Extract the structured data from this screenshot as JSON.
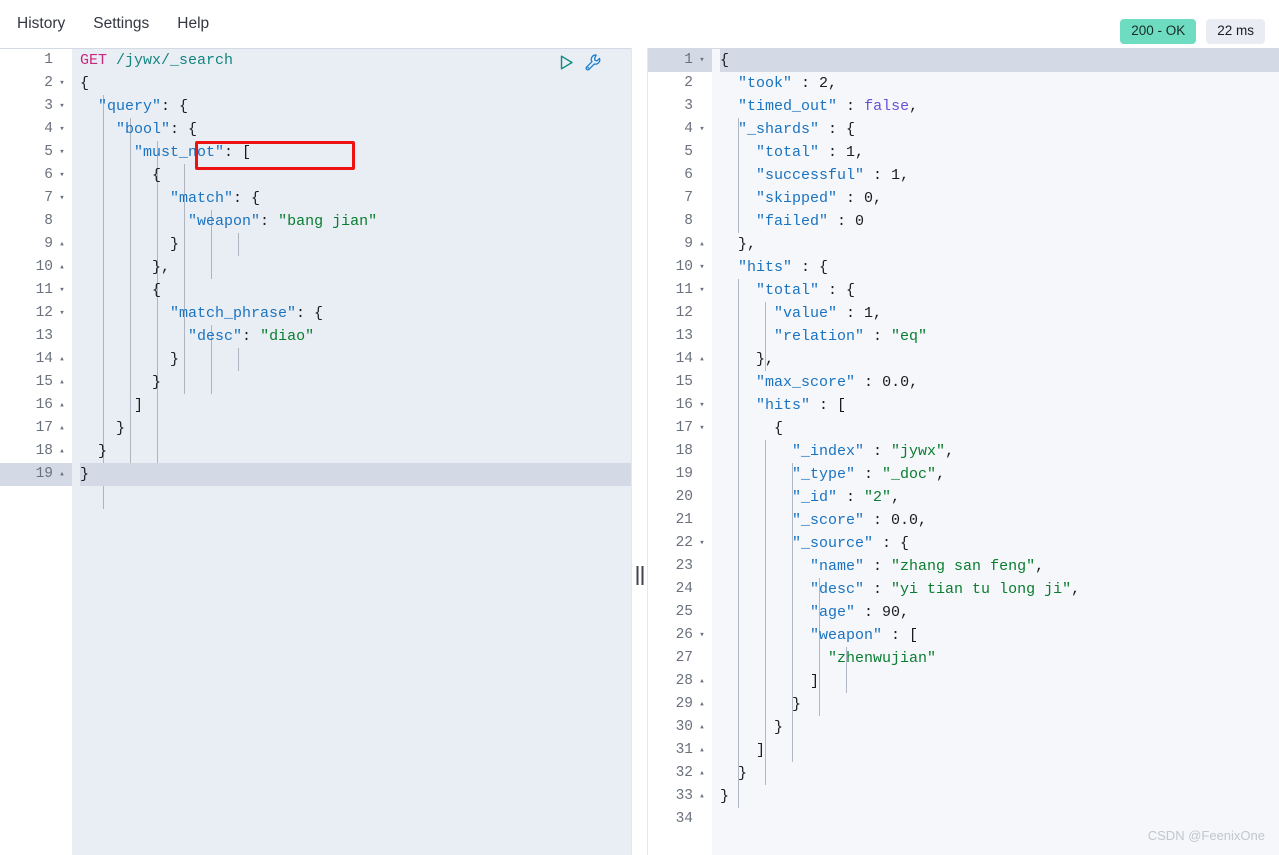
{
  "topbar": {
    "menu": [
      {
        "label": "History",
        "name": "menu-history"
      },
      {
        "label": "Settings",
        "name": "menu-settings"
      },
      {
        "label": "Help",
        "name": "menu-help"
      }
    ],
    "status_badge": "200 - OK",
    "time_badge": "22 ms",
    "status_color": "#6ddcc0"
  },
  "watermark": "CSDN @FeenixOne",
  "request_editor": {
    "active_line": 19,
    "run_icon": "play-icon",
    "wrench_icon": "wrench-icon",
    "lines": [
      {
        "n": 1,
        "fold": "",
        "tokens": [
          {
            "c": "t-method",
            "t": "GET"
          },
          {
            "c": "t-plain",
            "t": " "
          },
          {
            "c": "t-url",
            "t": "/jywx/_search"
          }
        ]
      },
      {
        "n": 2,
        "fold": "▾",
        "tokens": [
          {
            "c": "t-punc",
            "t": "{"
          }
        ]
      },
      {
        "n": 3,
        "fold": "▾",
        "tokens": [
          {
            "c": "t-plain",
            "t": "  "
          },
          {
            "c": "t-key",
            "t": "\"query\""
          },
          {
            "c": "t-punc",
            "t": ": {"
          }
        ]
      },
      {
        "n": 4,
        "fold": "▾",
        "tokens": [
          {
            "c": "t-plain",
            "t": "    "
          },
          {
            "c": "t-key",
            "t": "\"bool\""
          },
          {
            "c": "t-punc",
            "t": ": {"
          }
        ]
      },
      {
        "n": 5,
        "fold": "▾",
        "tokens": [
          {
            "c": "t-plain",
            "t": "      "
          },
          {
            "c": "t-key",
            "t": "\"must_not\""
          },
          {
            "c": "t-punc",
            "t": ": ["
          }
        ]
      },
      {
        "n": 6,
        "fold": "▾",
        "tokens": [
          {
            "c": "t-plain",
            "t": "        "
          },
          {
            "c": "t-punc",
            "t": "{"
          }
        ]
      },
      {
        "n": 7,
        "fold": "▾",
        "tokens": [
          {
            "c": "t-plain",
            "t": "          "
          },
          {
            "c": "t-key",
            "t": "\"match\""
          },
          {
            "c": "t-punc",
            "t": ": {"
          }
        ]
      },
      {
        "n": 8,
        "fold": "",
        "tokens": [
          {
            "c": "t-plain",
            "t": "            "
          },
          {
            "c": "t-key",
            "t": "\"weapon\""
          },
          {
            "c": "t-punc",
            "t": ": "
          },
          {
            "c": "t-str",
            "t": "\"bang jian\""
          }
        ]
      },
      {
        "n": 9,
        "fold": "▴",
        "tokens": [
          {
            "c": "t-plain",
            "t": "          "
          },
          {
            "c": "t-punc",
            "t": "}"
          }
        ]
      },
      {
        "n": 10,
        "fold": "▴",
        "tokens": [
          {
            "c": "t-plain",
            "t": "        "
          },
          {
            "c": "t-punc",
            "t": "},"
          }
        ]
      },
      {
        "n": 11,
        "fold": "▾",
        "tokens": [
          {
            "c": "t-plain",
            "t": "        "
          },
          {
            "c": "t-punc",
            "t": "{"
          }
        ]
      },
      {
        "n": 12,
        "fold": "▾",
        "tokens": [
          {
            "c": "t-plain",
            "t": "          "
          },
          {
            "c": "t-key",
            "t": "\"match_phrase\""
          },
          {
            "c": "t-punc",
            "t": ": {"
          }
        ]
      },
      {
        "n": 13,
        "fold": "",
        "tokens": [
          {
            "c": "t-plain",
            "t": "            "
          },
          {
            "c": "t-key",
            "t": "\"desc\""
          },
          {
            "c": "t-punc",
            "t": ": "
          },
          {
            "c": "t-str",
            "t": "\"diao\""
          }
        ]
      },
      {
        "n": 14,
        "fold": "▴",
        "tokens": [
          {
            "c": "t-plain",
            "t": "          "
          },
          {
            "c": "t-punc",
            "t": "}"
          }
        ]
      },
      {
        "n": 15,
        "fold": "▴",
        "tokens": [
          {
            "c": "t-plain",
            "t": "        "
          },
          {
            "c": "t-punc",
            "t": "}"
          }
        ]
      },
      {
        "n": 16,
        "fold": "▴",
        "tokens": [
          {
            "c": "t-plain",
            "t": "      "
          },
          {
            "c": "t-punc",
            "t": "]"
          }
        ]
      },
      {
        "n": 17,
        "fold": "▴",
        "tokens": [
          {
            "c": "t-plain",
            "t": "    "
          },
          {
            "c": "t-punc",
            "t": "}"
          }
        ]
      },
      {
        "n": 18,
        "fold": "▴",
        "tokens": [
          {
            "c": "t-plain",
            "t": "  "
          },
          {
            "c": "t-punc",
            "t": "}"
          }
        ]
      },
      {
        "n": 19,
        "fold": "▴",
        "tokens": [
          {
            "c": "t-punc",
            "t": "}"
          }
        ]
      }
    ]
  },
  "response_editor": {
    "active_line": 1,
    "lines": [
      {
        "n": 1,
        "fold": "▾",
        "tokens": [
          {
            "c": "t-punc",
            "t": "{"
          }
        ]
      },
      {
        "n": 2,
        "fold": "",
        "tokens": [
          {
            "c": "t-plain",
            "t": "  "
          },
          {
            "c": "t-key",
            "t": "\"took\""
          },
          {
            "c": "t-punc",
            "t": " : "
          },
          {
            "c": "t-num",
            "t": "2,"
          }
        ]
      },
      {
        "n": 3,
        "fold": "",
        "tokens": [
          {
            "c": "t-plain",
            "t": "  "
          },
          {
            "c": "t-key",
            "t": "\"timed_out\""
          },
          {
            "c": "t-punc",
            "t": " : "
          },
          {
            "c": "t-bool",
            "t": "false"
          },
          {
            "c": "t-punc",
            "t": ","
          }
        ]
      },
      {
        "n": 4,
        "fold": "▾",
        "tokens": [
          {
            "c": "t-plain",
            "t": "  "
          },
          {
            "c": "t-key",
            "t": "\"_shards\""
          },
          {
            "c": "t-punc",
            "t": " : {"
          }
        ]
      },
      {
        "n": 5,
        "fold": "",
        "tokens": [
          {
            "c": "t-plain",
            "t": "    "
          },
          {
            "c": "t-key",
            "t": "\"total\""
          },
          {
            "c": "t-punc",
            "t": " : "
          },
          {
            "c": "t-num",
            "t": "1,"
          }
        ]
      },
      {
        "n": 6,
        "fold": "",
        "tokens": [
          {
            "c": "t-plain",
            "t": "    "
          },
          {
            "c": "t-key",
            "t": "\"successful\""
          },
          {
            "c": "t-punc",
            "t": " : "
          },
          {
            "c": "t-num",
            "t": "1,"
          }
        ]
      },
      {
        "n": 7,
        "fold": "",
        "tokens": [
          {
            "c": "t-plain",
            "t": "    "
          },
          {
            "c": "t-key",
            "t": "\"skipped\""
          },
          {
            "c": "t-punc",
            "t": " : "
          },
          {
            "c": "t-num",
            "t": "0,"
          }
        ]
      },
      {
        "n": 8,
        "fold": "",
        "tokens": [
          {
            "c": "t-plain",
            "t": "    "
          },
          {
            "c": "t-key",
            "t": "\"failed\""
          },
          {
            "c": "t-punc",
            "t": " : "
          },
          {
            "c": "t-num",
            "t": "0"
          }
        ]
      },
      {
        "n": 9,
        "fold": "▴",
        "tokens": [
          {
            "c": "t-plain",
            "t": "  "
          },
          {
            "c": "t-punc",
            "t": "},"
          }
        ]
      },
      {
        "n": 10,
        "fold": "▾",
        "tokens": [
          {
            "c": "t-plain",
            "t": "  "
          },
          {
            "c": "t-key",
            "t": "\"hits\""
          },
          {
            "c": "t-punc",
            "t": " : {"
          }
        ]
      },
      {
        "n": 11,
        "fold": "▾",
        "tokens": [
          {
            "c": "t-plain",
            "t": "    "
          },
          {
            "c": "t-key",
            "t": "\"total\""
          },
          {
            "c": "t-punc",
            "t": " : {"
          }
        ]
      },
      {
        "n": 12,
        "fold": "",
        "tokens": [
          {
            "c": "t-plain",
            "t": "      "
          },
          {
            "c": "t-key",
            "t": "\"value\""
          },
          {
            "c": "t-punc",
            "t": " : "
          },
          {
            "c": "t-num",
            "t": "1,"
          }
        ]
      },
      {
        "n": 13,
        "fold": "",
        "tokens": [
          {
            "c": "t-plain",
            "t": "      "
          },
          {
            "c": "t-key",
            "t": "\"relation\""
          },
          {
            "c": "t-punc",
            "t": " : "
          },
          {
            "c": "t-str",
            "t": "\"eq\""
          }
        ]
      },
      {
        "n": 14,
        "fold": "▴",
        "tokens": [
          {
            "c": "t-plain",
            "t": "    "
          },
          {
            "c": "t-punc",
            "t": "},"
          }
        ]
      },
      {
        "n": 15,
        "fold": "",
        "tokens": [
          {
            "c": "t-plain",
            "t": "    "
          },
          {
            "c": "t-key",
            "t": "\"max_score\""
          },
          {
            "c": "t-punc",
            "t": " : "
          },
          {
            "c": "t-num",
            "t": "0.0,"
          }
        ]
      },
      {
        "n": 16,
        "fold": "▾",
        "tokens": [
          {
            "c": "t-plain",
            "t": "    "
          },
          {
            "c": "t-key",
            "t": "\"hits\""
          },
          {
            "c": "t-punc",
            "t": " : ["
          }
        ]
      },
      {
        "n": 17,
        "fold": "▾",
        "tokens": [
          {
            "c": "t-plain",
            "t": "      "
          },
          {
            "c": "t-punc",
            "t": "{"
          }
        ]
      },
      {
        "n": 18,
        "fold": "",
        "tokens": [
          {
            "c": "t-plain",
            "t": "        "
          },
          {
            "c": "t-key",
            "t": "\"_index\""
          },
          {
            "c": "t-punc",
            "t": " : "
          },
          {
            "c": "t-str",
            "t": "\"jywx\""
          },
          {
            "c": "t-punc",
            "t": ","
          }
        ]
      },
      {
        "n": 19,
        "fold": "",
        "tokens": [
          {
            "c": "t-plain",
            "t": "        "
          },
          {
            "c": "t-key",
            "t": "\"_type\""
          },
          {
            "c": "t-punc",
            "t": " : "
          },
          {
            "c": "t-str",
            "t": "\"_doc\""
          },
          {
            "c": "t-punc",
            "t": ","
          }
        ]
      },
      {
        "n": 20,
        "fold": "",
        "tokens": [
          {
            "c": "t-plain",
            "t": "        "
          },
          {
            "c": "t-key",
            "t": "\"_id\""
          },
          {
            "c": "t-punc",
            "t": " : "
          },
          {
            "c": "t-str",
            "t": "\"2\""
          },
          {
            "c": "t-punc",
            "t": ","
          }
        ]
      },
      {
        "n": 21,
        "fold": "",
        "tokens": [
          {
            "c": "t-plain",
            "t": "        "
          },
          {
            "c": "t-key",
            "t": "\"_score\""
          },
          {
            "c": "t-punc",
            "t": " : "
          },
          {
            "c": "t-num",
            "t": "0.0,"
          }
        ]
      },
      {
        "n": 22,
        "fold": "▾",
        "tokens": [
          {
            "c": "t-plain",
            "t": "        "
          },
          {
            "c": "t-key",
            "t": "\"_source\""
          },
          {
            "c": "t-punc",
            "t": " : {"
          }
        ]
      },
      {
        "n": 23,
        "fold": "",
        "tokens": [
          {
            "c": "t-plain",
            "t": "          "
          },
          {
            "c": "t-key",
            "t": "\"name\""
          },
          {
            "c": "t-punc",
            "t": " : "
          },
          {
            "c": "t-str",
            "t": "\"zhang san feng\""
          },
          {
            "c": "t-punc",
            "t": ","
          }
        ]
      },
      {
        "n": 24,
        "fold": "",
        "tokens": [
          {
            "c": "t-plain",
            "t": "          "
          },
          {
            "c": "t-key",
            "t": "\"desc\""
          },
          {
            "c": "t-punc",
            "t": " : "
          },
          {
            "c": "t-str",
            "t": "\"yi tian tu long ji\""
          },
          {
            "c": "t-punc",
            "t": ","
          }
        ]
      },
      {
        "n": 25,
        "fold": "",
        "tokens": [
          {
            "c": "t-plain",
            "t": "          "
          },
          {
            "c": "t-key",
            "t": "\"age\""
          },
          {
            "c": "t-punc",
            "t": " : "
          },
          {
            "c": "t-num",
            "t": "90,"
          }
        ]
      },
      {
        "n": 26,
        "fold": "▾",
        "tokens": [
          {
            "c": "t-plain",
            "t": "          "
          },
          {
            "c": "t-key",
            "t": "\"weapon\""
          },
          {
            "c": "t-punc",
            "t": " : ["
          }
        ]
      },
      {
        "n": 27,
        "fold": "",
        "tokens": [
          {
            "c": "t-plain",
            "t": "            "
          },
          {
            "c": "t-str",
            "t": "\"zhenwujian\""
          }
        ]
      },
      {
        "n": 28,
        "fold": "▴",
        "tokens": [
          {
            "c": "t-plain",
            "t": "          "
          },
          {
            "c": "t-punc",
            "t": "]"
          }
        ]
      },
      {
        "n": 29,
        "fold": "▴",
        "tokens": [
          {
            "c": "t-plain",
            "t": "        "
          },
          {
            "c": "t-punc",
            "t": "}"
          }
        ]
      },
      {
        "n": 30,
        "fold": "▴",
        "tokens": [
          {
            "c": "t-plain",
            "t": "      "
          },
          {
            "c": "t-punc",
            "t": "}"
          }
        ]
      },
      {
        "n": 31,
        "fold": "▴",
        "tokens": [
          {
            "c": "t-plain",
            "t": "    "
          },
          {
            "c": "t-punc",
            "t": "]"
          }
        ]
      },
      {
        "n": 32,
        "fold": "▴",
        "tokens": [
          {
            "c": "t-plain",
            "t": "  "
          },
          {
            "c": "t-punc",
            "t": "}"
          }
        ]
      },
      {
        "n": 33,
        "fold": "▴",
        "tokens": [
          {
            "c": "t-punc",
            "t": "}"
          }
        ]
      },
      {
        "n": 34,
        "fold": "",
        "tokens": []
      }
    ]
  },
  "annotation": {
    "label": "must_not-highlight",
    "color": "#ee1111"
  }
}
